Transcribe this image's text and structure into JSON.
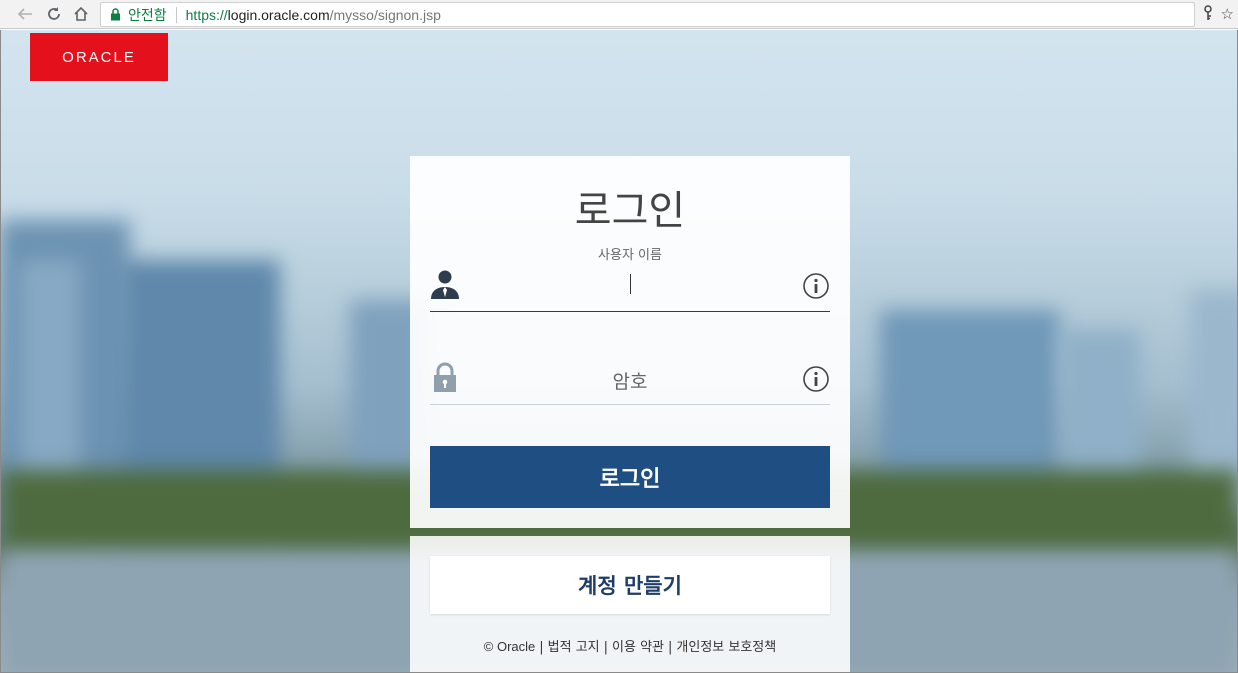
{
  "browser": {
    "secure_label": "안전함",
    "url_scheme": "https://",
    "url_host": "login.oracle.com",
    "url_path": "/mysso/signon.jsp"
  },
  "logo": {
    "text": "ORACLE"
  },
  "login": {
    "title": "로그인",
    "username_label": "사용자 이름",
    "password_placeholder": "암호",
    "submit_label": "로그인"
  },
  "account": {
    "create_label": "계정 만들기"
  },
  "footer": {
    "copyright": "© Oracle",
    "legal": "법적 고지",
    "terms": "이용 약관",
    "privacy": "개인정보 보호정책"
  },
  "colors": {
    "brand_red": "#e4101c",
    "button_blue": "#1f4e82",
    "secure_green": "#0b8043"
  }
}
